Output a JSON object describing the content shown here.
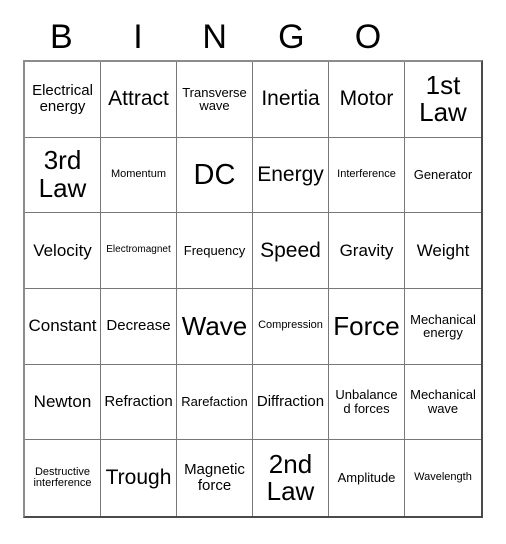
{
  "header": {
    "letters": [
      "B",
      "I",
      "N",
      "G",
      "O",
      ""
    ]
  },
  "grid": {
    "rows": 6,
    "columns": 6,
    "cells": [
      [
        {
          "text": "Electrical energy",
          "size": "fs-s"
        },
        {
          "text": "Attract",
          "size": "fs-l"
        },
        {
          "text": "Transverse wave",
          "size": "fs-xs"
        },
        {
          "text": "Inertia",
          "size": "fs-l"
        },
        {
          "text": "Motor",
          "size": "fs-l"
        },
        {
          "text": "1st Law",
          "size": "fs-xl"
        }
      ],
      [
        {
          "text": "3rd Law",
          "size": "fs-xl"
        },
        {
          "text": "Momentum",
          "size": "fs-xxs"
        },
        {
          "text": "DC",
          "size": "fs-xxl"
        },
        {
          "text": "Energy",
          "size": "fs-l"
        },
        {
          "text": "Interference",
          "size": "fs-xxs"
        },
        {
          "text": "Generator",
          "size": "fs-xs"
        }
      ],
      [
        {
          "text": "Velocity",
          "size": "fs-m"
        },
        {
          "text": "Electromagnet",
          "size": "fs-tiny"
        },
        {
          "text": "Frequency",
          "size": "fs-xs"
        },
        {
          "text": "Speed",
          "size": "fs-l"
        },
        {
          "text": "Gravity",
          "size": "fs-m"
        },
        {
          "text": "Weight",
          "size": "fs-m"
        }
      ],
      [
        {
          "text": "Constant",
          "size": "fs-m"
        },
        {
          "text": "Decrease",
          "size": "fs-s"
        },
        {
          "text": "Wave",
          "size": "fs-xl"
        },
        {
          "text": "Compression",
          "size": "fs-xxs"
        },
        {
          "text": "Force",
          "size": "fs-xl"
        },
        {
          "text": "Mechanical energy",
          "size": "fs-xs"
        }
      ],
      [
        {
          "text": "Newton",
          "size": "fs-m"
        },
        {
          "text": "Refraction",
          "size": "fs-s"
        },
        {
          "text": "Rarefaction",
          "size": "fs-xs"
        },
        {
          "text": "Diffraction",
          "size": "fs-s"
        },
        {
          "text": "Unbalanced forces",
          "size": "fs-xs"
        },
        {
          "text": "Mechanical wave",
          "size": "fs-xs"
        }
      ],
      [
        {
          "text": "Destructive interference",
          "size": "fs-xxs"
        },
        {
          "text": "Trough",
          "size": "fs-l"
        },
        {
          "text": "Magnetic force",
          "size": "fs-s"
        },
        {
          "text": "2nd Law",
          "size": "fs-xl"
        },
        {
          "text": "Amplitude",
          "size": "fs-xs"
        },
        {
          "text": "Wavelength",
          "size": "fs-xxs"
        }
      ]
    ]
  },
  "colors": {
    "background": "#ffffff",
    "text": "#000000",
    "grid_line": "#777777",
    "outer_border": "#4a4a4a"
  }
}
